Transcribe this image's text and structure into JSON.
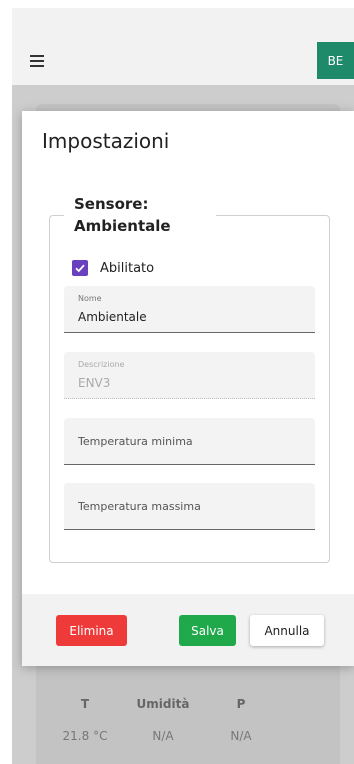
{
  "header": {
    "avatar_initials": "BE"
  },
  "dialog": {
    "title": "Impostazioni",
    "fieldset_legend": "Sensore: Ambientale",
    "enabled_label": "Abilitato",
    "enabled_checked": true,
    "fields": {
      "name": {
        "label": "Nome",
        "value": "Ambientale"
      },
      "description": {
        "label": "Descrizione",
        "value": "ENV3"
      },
      "min_temp": {
        "placeholder": "Temperatura minima"
      },
      "max_temp": {
        "placeholder": "Temperatura massima"
      }
    },
    "buttons": {
      "delete": "Elimina",
      "save": "Salva",
      "cancel": "Annulla"
    }
  },
  "background_table": {
    "headers": [
      "T",
      "Umidità",
      "P"
    ],
    "values": [
      "21.8 °C",
      "N/A",
      "N/A"
    ]
  },
  "colors": {
    "avatar": "#1e8a6a",
    "checkbox": "#6a3fc0",
    "delete": "#ef3a3a",
    "save": "#1fa94a"
  }
}
